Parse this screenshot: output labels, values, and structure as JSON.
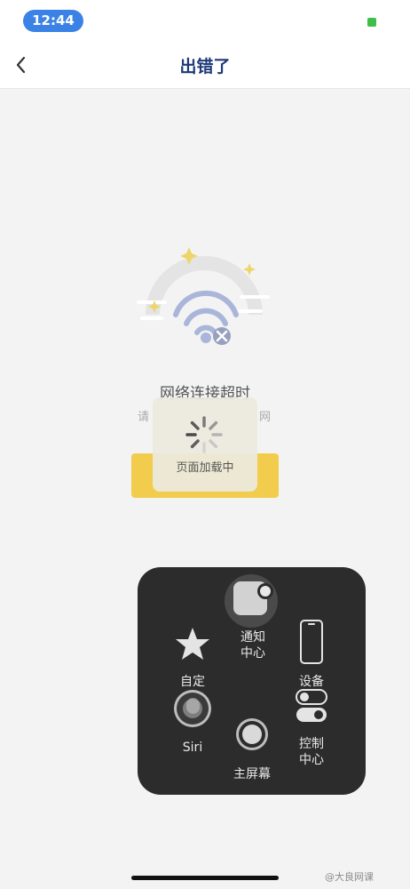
{
  "status": {
    "time": "12:44"
  },
  "nav": {
    "title": "出错了"
  },
  "error": {
    "title": "网络连接超时",
    "subtitle_left": "请",
    "subtitle_right": "网"
  },
  "toast": {
    "label": "页面加载中"
  },
  "assistive_touch": {
    "notification_center": [
      "通知",
      "中心"
    ],
    "custom": "自定",
    "device": "设备",
    "siri": "Siri",
    "control_center": [
      "控制",
      "中心"
    ],
    "home": "主屏幕"
  },
  "watermark": "@大良网课",
  "colors": {
    "accent": "#3b82e6",
    "title": "#1e3a78",
    "button": "#f2cd4d",
    "panel": "#2c2c2c"
  }
}
